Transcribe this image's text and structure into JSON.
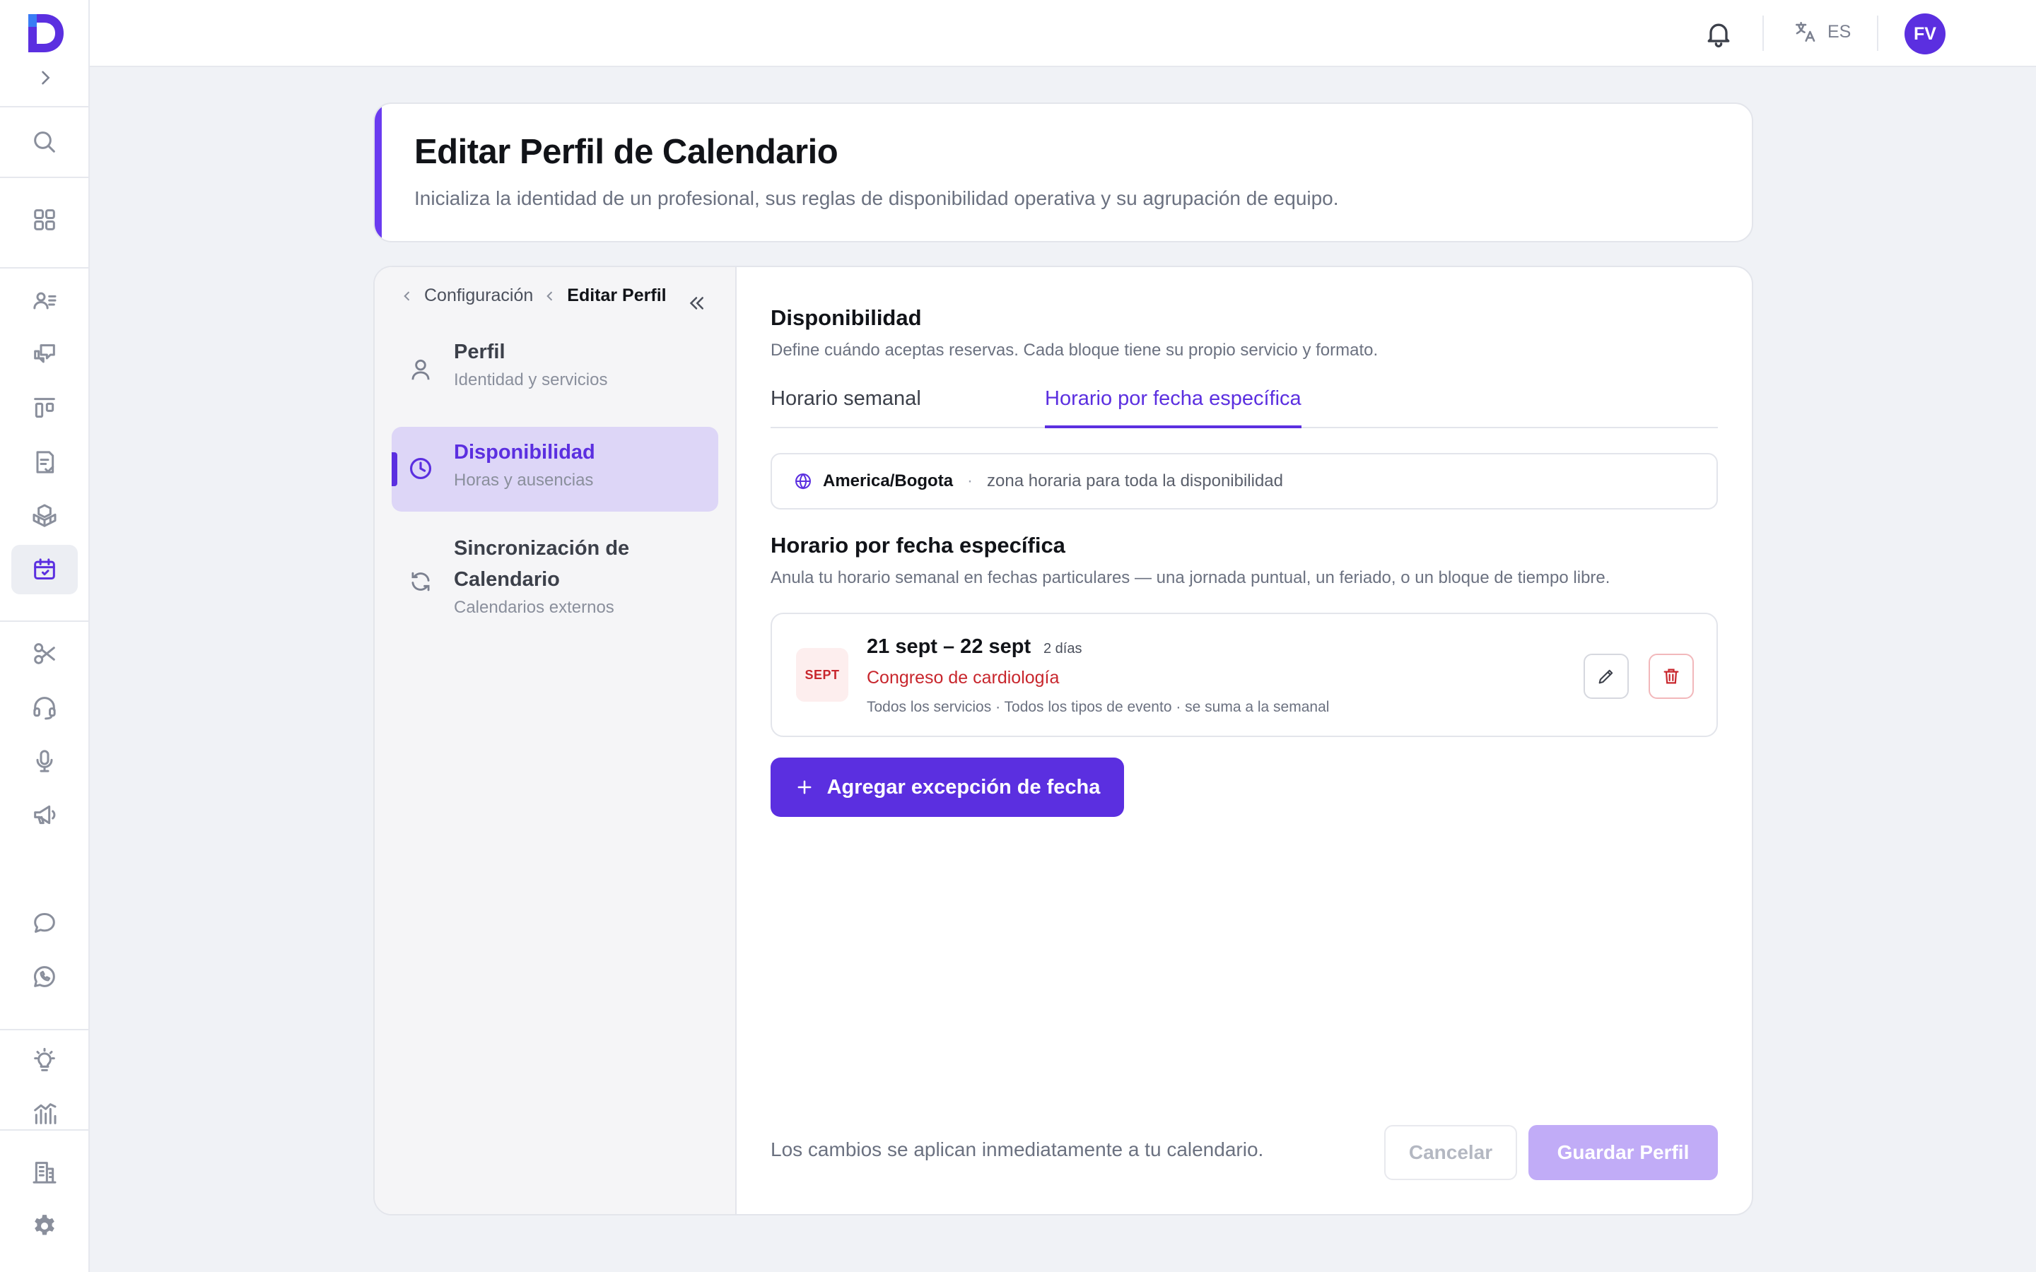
{
  "colors": {
    "accent": "#5b2fe0",
    "danger": "#c8262d",
    "background": "#f0f2f6"
  },
  "rail": {
    "icons": [
      "brand-logo-icon",
      "chevron-right-icon",
      "search-icon",
      "grid-icon",
      "contacts-icon",
      "chat-bubbles-icon",
      "kanban-icon",
      "checklist-icon",
      "boxes-icon",
      "calendar-icon",
      "scissors-icon",
      "headset-icon",
      "microphone-icon",
      "megaphone-icon",
      "message-icon",
      "whatsapp-icon",
      "lightbulb-icon",
      "bar-chart-icon",
      "building-icon",
      "gear-icon"
    ],
    "active": "calendar-icon"
  },
  "topbar": {
    "language": "ES",
    "avatar_initials": "FV"
  },
  "header": {
    "title": "Editar Perfil de Calendario",
    "subtitle": "Inicializa la identidad de un profesional, sus reglas de disponibilidad operativa y su agrupación de equipo."
  },
  "breadcrumb": {
    "parent": "Configuración",
    "current": "Editar Perfil"
  },
  "nav": {
    "items": [
      {
        "title": "Perfil",
        "subtitle": "Identidad y servicios"
      },
      {
        "title": "Disponibilidad",
        "subtitle": "Horas y ausencias"
      },
      {
        "title": "Sincronización de Calendario",
        "title_line1": "Sincronización de",
        "title_line2": "Calendario",
        "subtitle": "Calendarios externos"
      }
    ],
    "active_index": 1
  },
  "availability": {
    "title": "Disponibilidad",
    "description": "Define cuándo aceptas reservas. Cada bloque tiene su propio servicio y formato.",
    "tabs": [
      "Horario semanal",
      "Horario por fecha específica"
    ],
    "active_tab": 1,
    "timezone": {
      "zone": "America/Bogota",
      "separator": "·",
      "note": "zona horaria para toda la disponibilidad"
    },
    "section_title": "Horario por fecha específica",
    "section_description": "Anula tu horario semanal en fechas particulares — una jornada puntual, un feriado, o un bloque de tiempo libre.",
    "exceptions": [
      {
        "month": "SEPT",
        "range": "21 sept – 22 sept",
        "days": "2 días",
        "name": "Congreso de cardiología",
        "meta": "Todos los servicios · Todos los tipos de evento · se suma a la semanal"
      }
    ],
    "add_button": "Agregar excepción de fecha"
  },
  "footer": {
    "note": "Los cambios se aplican inmediatamente a tu calendario.",
    "cancel": "Cancelar",
    "save": "Guardar Perfil"
  }
}
